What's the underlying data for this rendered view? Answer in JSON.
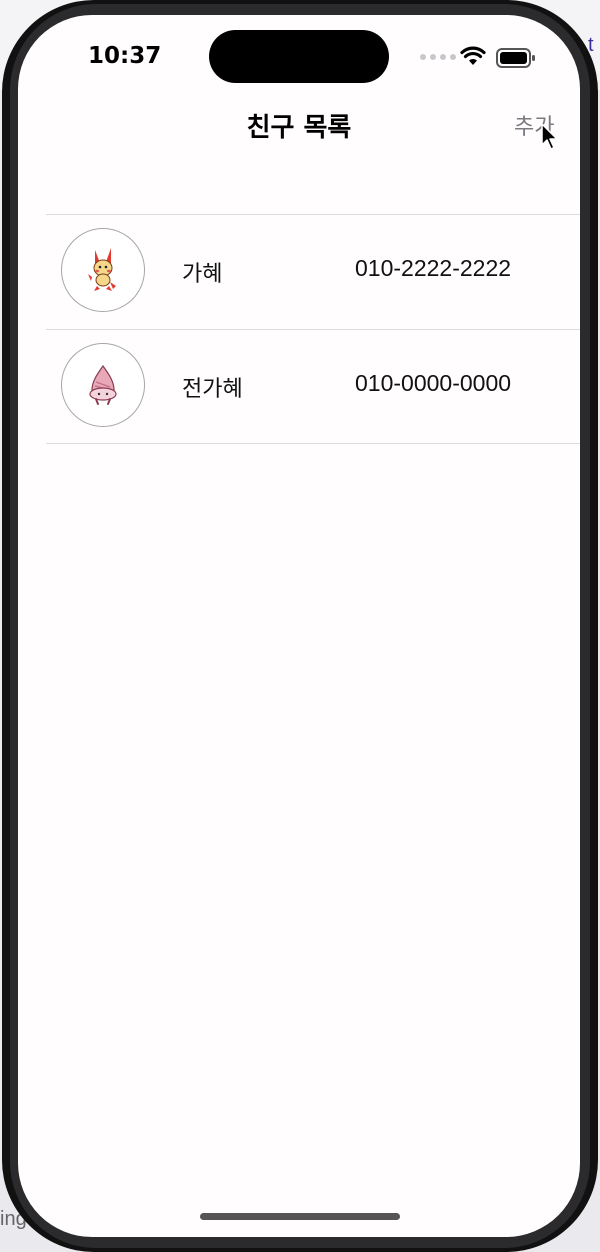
{
  "status_bar": {
    "time": "10:37",
    "icons": [
      "cellular-dots-icon",
      "wifi-icon",
      "battery-icon"
    ]
  },
  "nav_bar": {
    "title": "친구 목록",
    "add_label": "추가"
  },
  "friends": [
    {
      "name": "가혜",
      "phone": "010-2222-2222",
      "avatar_icon": "pokemon-plusle-icon"
    },
    {
      "name": "전가혜",
      "phone": "010-0000-0000",
      "avatar_icon": "pokemon-clefairy-bell-icon"
    }
  ],
  "background": {
    "edge_text_left": "ing",
    "edge_text_right": "t"
  },
  "colors": {
    "screen_bg": "#fffdfe",
    "nav_button": "#7a7a80",
    "separator": "#dcdcde"
  }
}
